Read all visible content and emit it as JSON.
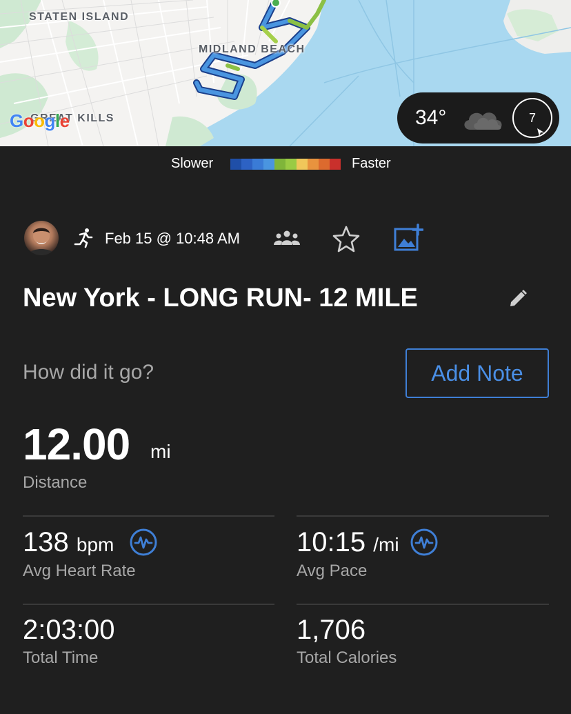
{
  "map": {
    "labels": {
      "staten_island": "STATEN ISLAND",
      "midland_beach": "MIDLAND BEACH",
      "great_kills": "GREAT KILLS"
    },
    "logo": "Google",
    "weather": {
      "temperature": "34°",
      "wind_speed": "7",
      "condition_icon": "cloud-icon"
    }
  },
  "legend": {
    "slower": "Slower",
    "faster": "Faster",
    "colors": [
      "#1f4fa8",
      "#2d62c4",
      "#3a7bd6",
      "#4a95e0",
      "#7fb53a",
      "#9acb44",
      "#f0c75a",
      "#e8933e",
      "#dc6a2e",
      "#c9302c"
    ]
  },
  "activity": {
    "type_icon": "running-icon",
    "date": "Feb 15 @ 10:48 AM",
    "title": "New York - LONG RUN- 12 MILE"
  },
  "note": {
    "prompt": "How did it go?",
    "button_label": "Add Note"
  },
  "stats": {
    "distance": {
      "value": "12.00",
      "unit": "mi",
      "label": "Distance"
    },
    "heart_rate": {
      "value": "138",
      "unit": "bpm",
      "label": "Avg Heart Rate"
    },
    "pace": {
      "value": "10:15",
      "unit": "/mi",
      "label": "Avg Pace"
    },
    "time": {
      "value": "2:03:00",
      "label": "Total Time"
    },
    "calories": {
      "value": "1,706",
      "label": "Total Calories"
    }
  },
  "colors": {
    "accent": "#4a8fe6",
    "background": "#1f1f1f",
    "label_gray": "#a7a7a7"
  }
}
